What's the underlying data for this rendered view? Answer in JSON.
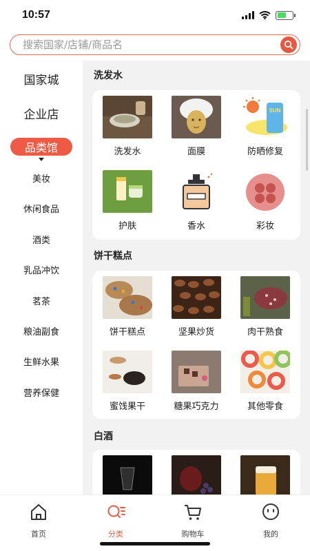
{
  "status": {
    "time": "10:57"
  },
  "search": {
    "placeholder": "搜索国家/店铺/商品名"
  },
  "nav": {
    "top_items": [
      "国家城",
      "企业店"
    ],
    "active": "品类馆",
    "sub_items": [
      "美妆",
      "休闲食品",
      "酒类",
      "乳品冲饮",
      "茗茶",
      "粮油副食",
      "生鲜水果",
      "营养保健"
    ]
  },
  "sections": [
    {
      "title": "洗发水",
      "items": [
        "洗发水",
        "面膜",
        "防晒修复",
        "护肤",
        "香水",
        "彩妆"
      ]
    },
    {
      "title": "饼干糕点",
      "items": [
        "饼干糕点",
        "坚果炒货",
        "肉干熟食",
        "蜜饯果干",
        "糖果巧克力",
        "其他零食"
      ]
    },
    {
      "title": "白酒",
      "items": [
        "",
        "",
        ""
      ]
    }
  ],
  "sunscreen_sticker": "SUN",
  "tabs": [
    {
      "label": "首页",
      "icon": "home-icon"
    },
    {
      "label": "分类",
      "icon": "category-icon",
      "active": true
    },
    {
      "label": "购物车",
      "icon": "cart-icon"
    },
    {
      "label": "我的",
      "icon": "profile-icon"
    }
  ],
  "colors": {
    "accent": "#ef5a44",
    "background": "#f2f2f2"
  }
}
